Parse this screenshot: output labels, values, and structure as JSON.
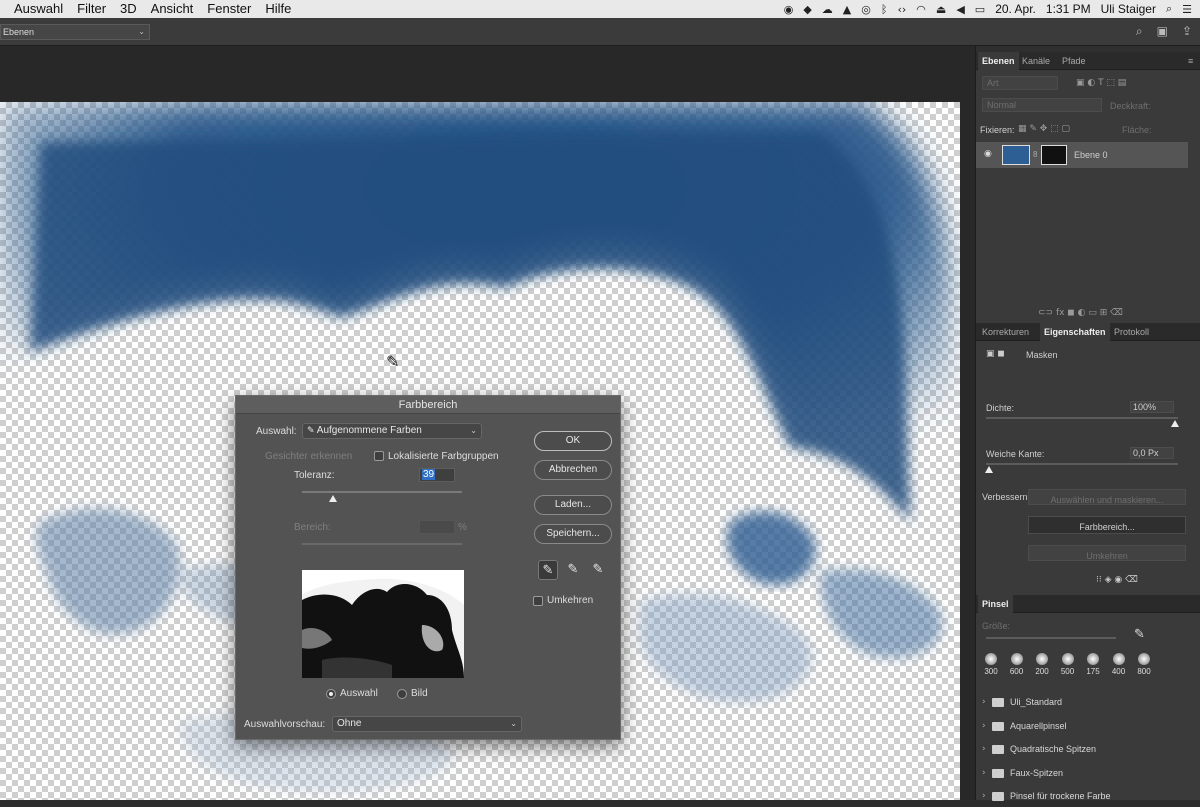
{
  "menubar": {
    "items": [
      "Auswahl",
      "Filter",
      "3D",
      "Ansicht",
      "Fenster",
      "Hilfe"
    ],
    "date": "20. Apr.",
    "time": "1:31 PM",
    "user": "Uli Staiger"
  },
  "options_bar": {
    "selector_value": "Ebenen"
  },
  "dialog": {
    "title": "Farbbereich",
    "auswahl_label": "Auswahl:",
    "auswahl_value": "Aufgenommene Farben",
    "gesichter_label": "Gesichter erkennen",
    "lokalisierte_label": "Lokalisierte Farbgruppen",
    "toleranz_label": "Toleranz:",
    "toleranz_value": "39",
    "toleranz_fraction": 0.195,
    "bereich_label": "Bereich:",
    "bereich_unit": "%",
    "preview_radio_auswahl": "Auswahl",
    "preview_radio_bild": "Bild",
    "vorschau_label": "Auswahlvorschau:",
    "vorschau_value": "Ohne",
    "buttons": {
      "ok": "OK",
      "cancel": "Abbrechen",
      "load": "Laden...",
      "save": "Speichern..."
    },
    "umkehren_label": "Umkehren"
  },
  "layers_panel": {
    "tabs": [
      "Ebenen",
      "Kanäle",
      "Pfade"
    ],
    "filter_placeholder": "Art",
    "blend_mode": "Normal",
    "opacity_label": "Deckkraft:",
    "lock_label": "Fixieren:",
    "fill_label": "Fläche:",
    "layer_name": "Ebene 0"
  },
  "properties_panel": {
    "tabs": [
      "Korrekturen",
      "Eigenschaften",
      "Protokoll"
    ],
    "section": "Masken",
    "dichte_label": "Dichte:",
    "dichte_value": "100%",
    "kante_label": "Weiche Kante:",
    "kante_value": "0,0 Px",
    "verbessern_label": "Verbessern:",
    "btn_auswaehlen": "Auswählen und maskieren...",
    "btn_farbbereich": "Farbbereich...",
    "btn_umkehren": "Umkehren"
  },
  "brush_panel": {
    "title": "Pinsel",
    "size_label": "Größe:",
    "presets": [
      "300",
      "600",
      "200",
      "500",
      "175",
      "400",
      "800"
    ],
    "folders": [
      "Uli_Standard",
      "Aquarellpinsel",
      "Quadratische Spitzen",
      "Faux-Spitzen",
      "Pinsel für trockene Farbe"
    ]
  }
}
